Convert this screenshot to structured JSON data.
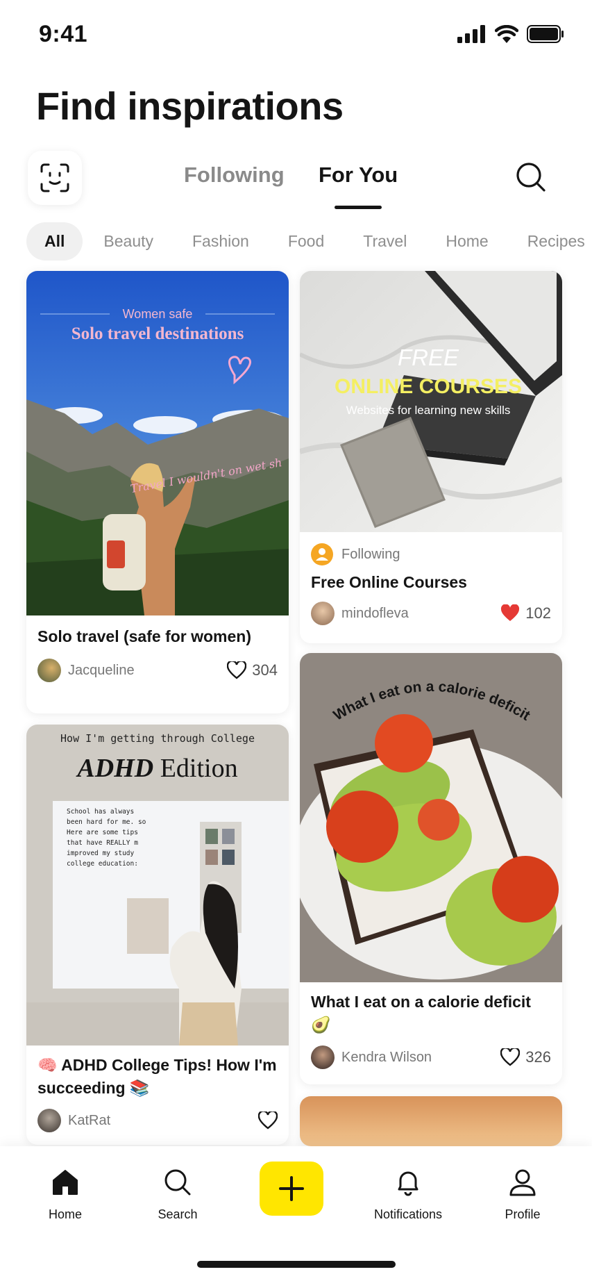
{
  "status": {
    "time": "9:41"
  },
  "header": {
    "title": "Find inspirations"
  },
  "feed_tabs": [
    {
      "label": "Following",
      "active": false
    },
    {
      "label": "For You",
      "active": true
    }
  ],
  "categories": [
    "All",
    "Beauty",
    "Fashion",
    "Food",
    "Travel",
    "Home",
    "Recipes"
  ],
  "cards": {
    "solo": {
      "overlay_small": "Women safe",
      "overlay_big": "Solo travel destinations",
      "handwriting": "Travel I wouldn't on wet sh",
      "title": "Solo travel (safe for women)",
      "author": "Jacqueline",
      "likes": "304"
    },
    "courses": {
      "overlay_1": "FREE",
      "overlay_2": "ONLINE COURSES",
      "overlay_3": "Websites for learning new skills",
      "status": "Following",
      "title": "Free Online Courses",
      "author": "mindofleva",
      "likes": "102"
    },
    "adhd": {
      "overlay_small": "How I'm getting through College",
      "overlay_big_italic": "ADHD",
      "overlay_big": "Edition",
      "board_text": "School has always been hard for me. so Here are some tips that have REALLY m improved my study college education:",
      "title": "🧠 ADHD College Tips! How I'm succeeding 📚",
      "author": "KatRat"
    },
    "calorie": {
      "overlay": "What I eat on a calorie deficit",
      "title": "What I eat on a calorie deficit 🥑",
      "author": "Kendra Wilson",
      "likes": "326"
    }
  },
  "bottom_nav": [
    {
      "label": "Home",
      "icon": "home-icon"
    },
    {
      "label": "Search",
      "icon": "search-icon"
    },
    {
      "label": "",
      "icon": "plus-icon"
    },
    {
      "label": "Notifications",
      "icon": "bell-icon"
    },
    {
      "label": "Profile",
      "icon": "person-icon"
    }
  ],
  "colors": {
    "accent": "#ffe600",
    "like_red": "#e53935",
    "following_badge": "#f5a623"
  }
}
